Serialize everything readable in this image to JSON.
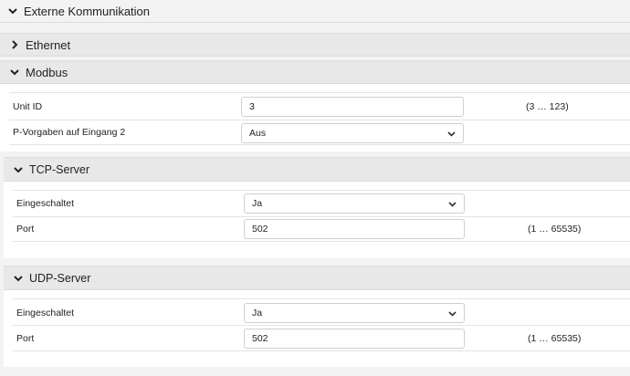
{
  "sections": {
    "extern": {
      "title": "Externe Kommunikation"
    },
    "ethernet": {
      "title": "Ethernet"
    },
    "modbus": {
      "title": "Modbus",
      "rows": [
        {
          "label": "Unit ID",
          "value": "3",
          "range": "(3 … 123)"
        },
        {
          "label": "P-Vorgaben auf Eingang 2",
          "value": "Aus"
        }
      ]
    },
    "tcp": {
      "title": "TCP-Server",
      "rows": [
        {
          "label": "Eingeschaltet",
          "value": "Ja"
        },
        {
          "label": "Port",
          "value": "502",
          "range": "(1 … 65535)"
        }
      ]
    },
    "udp": {
      "title": "UDP-Server",
      "rows": [
        {
          "label": "Eingeschaltet",
          "value": "Ja"
        },
        {
          "label": "Port",
          "value": "502",
          "range": "(1 … 65535)"
        }
      ]
    }
  },
  "icons": {
    "expanded": "chevron-down-icon",
    "collapsed": "chevron-right-icon",
    "select": "caret-down-icon"
  }
}
